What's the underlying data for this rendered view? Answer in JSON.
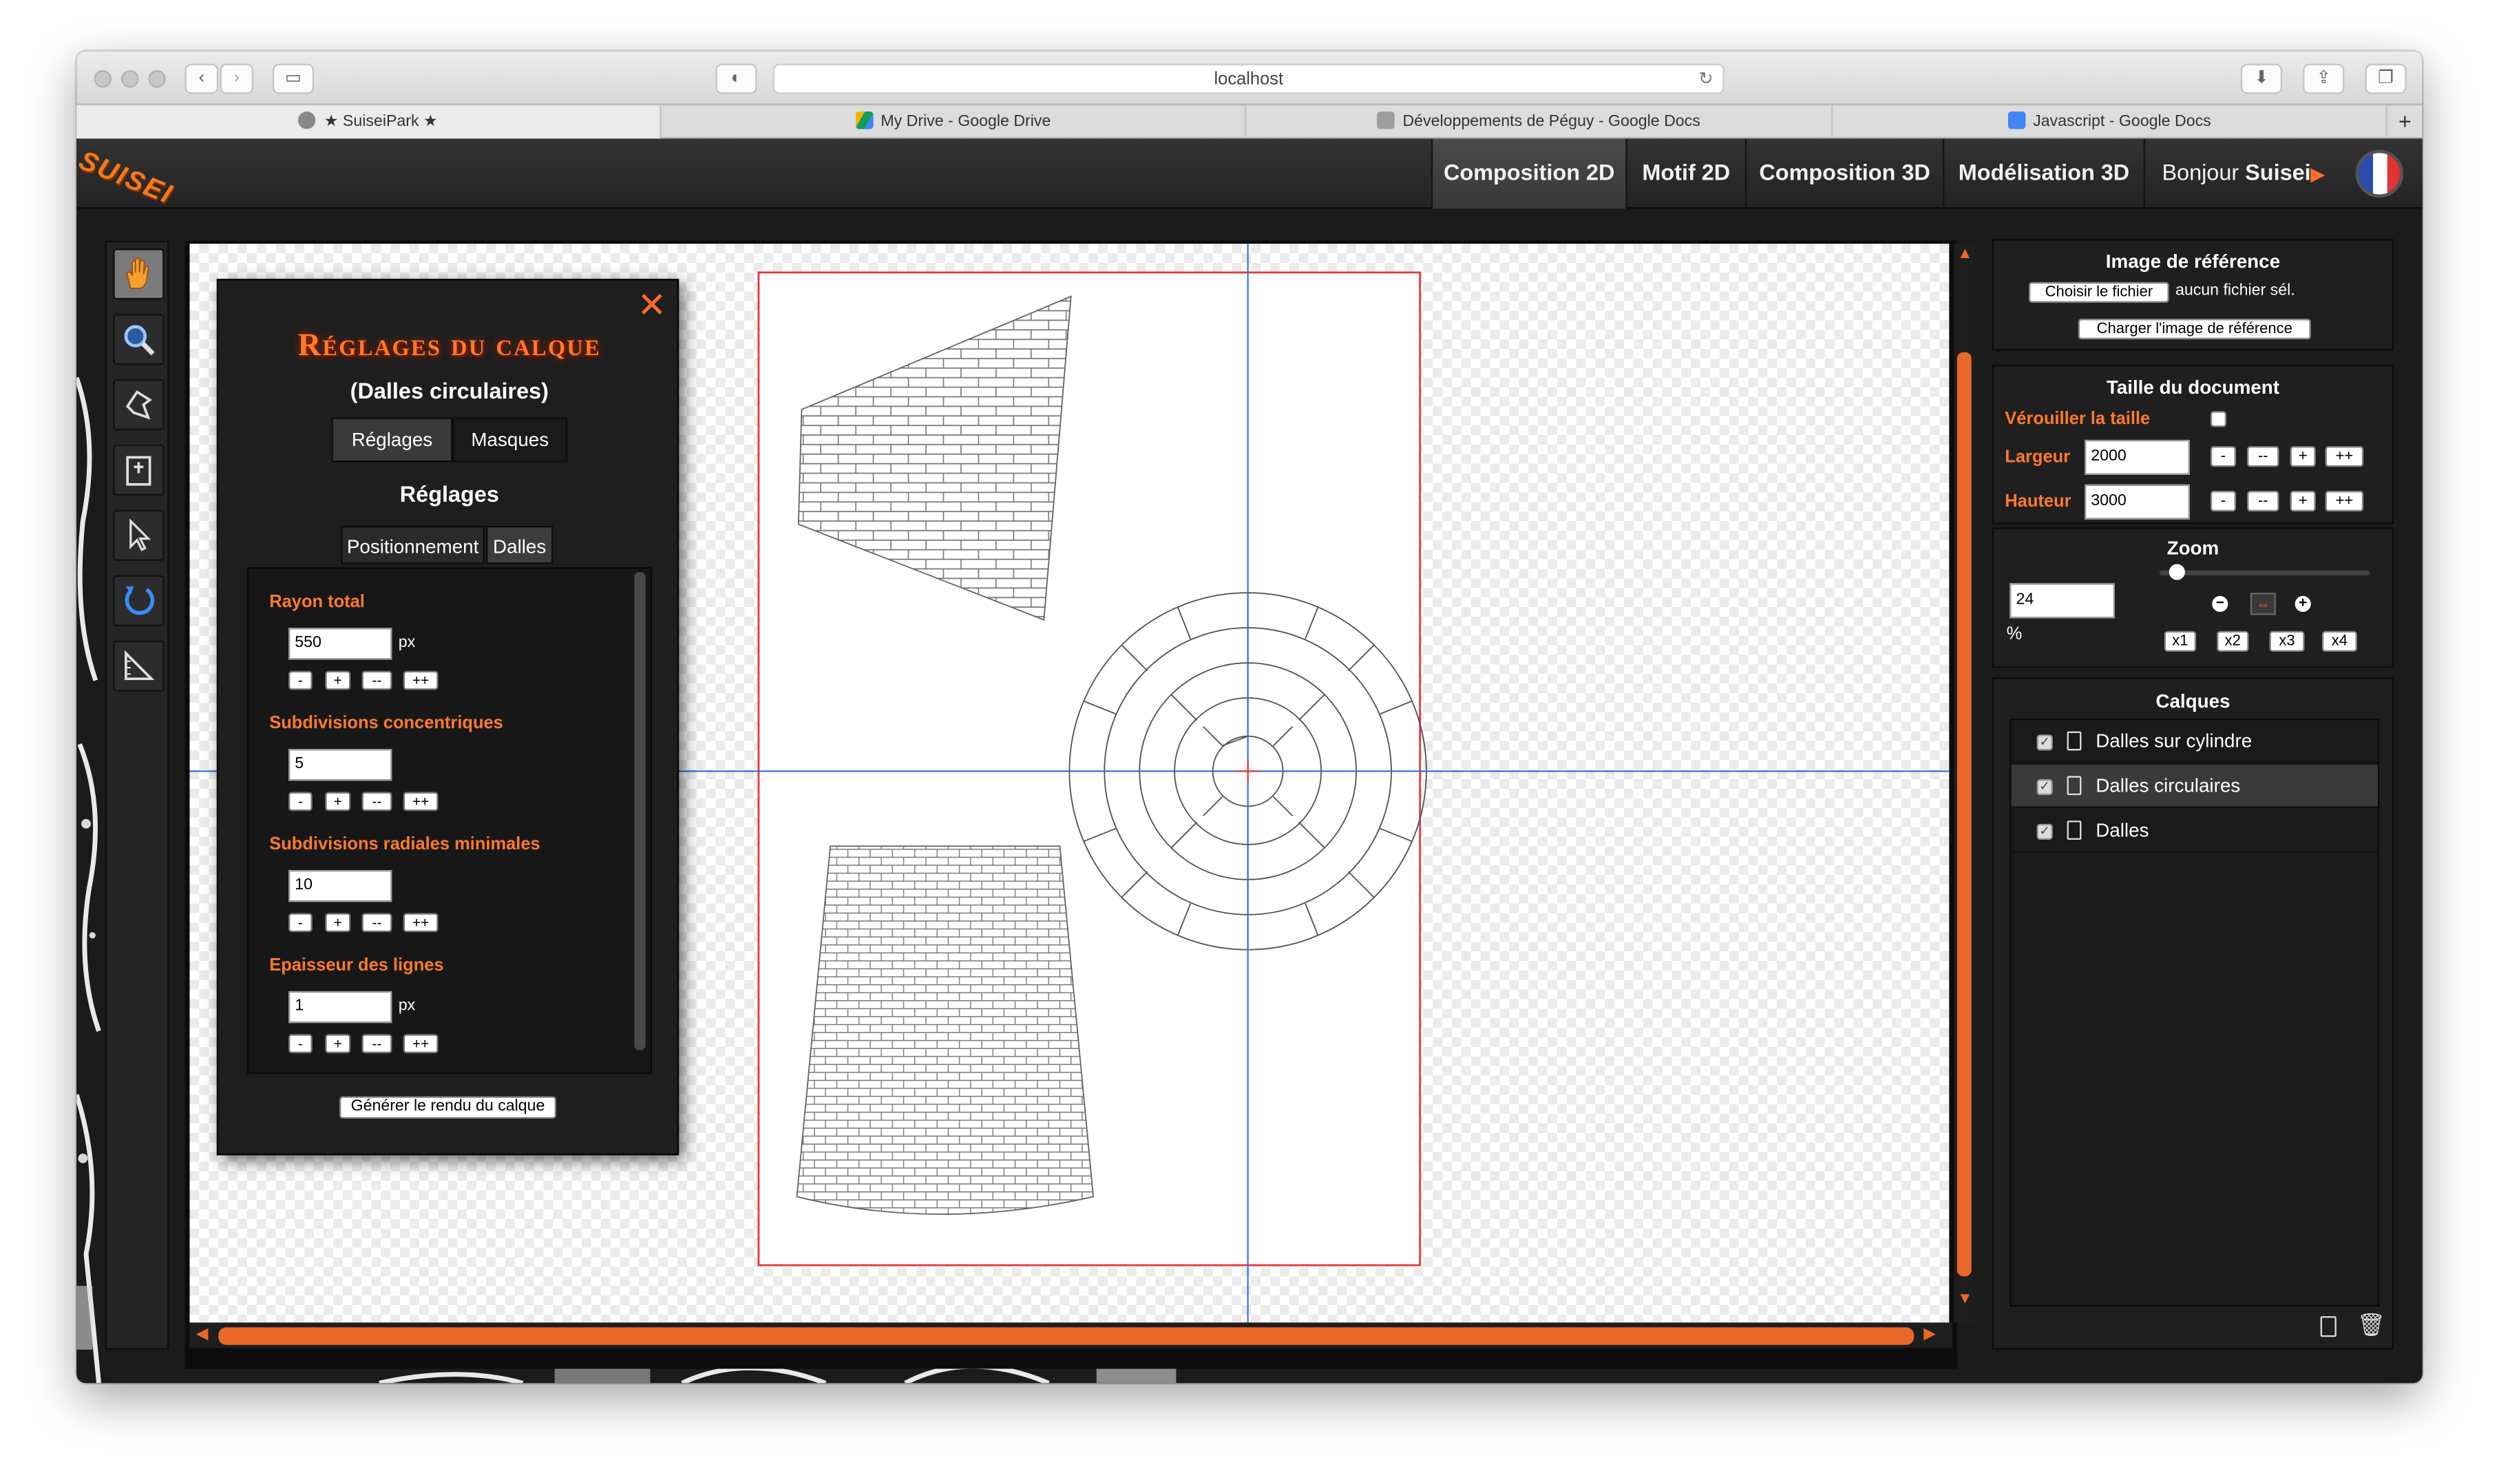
{
  "browser": {
    "url": "localhost",
    "tabs": [
      {
        "label": "★ SuiseiPark ★"
      },
      {
        "label": "My Drive - Google Drive"
      },
      {
        "label": "Développements de Péguy - Google Docs"
      },
      {
        "label": "Javascript - Google Docs"
      }
    ],
    "new_tab": "+"
  },
  "app": {
    "logo": "SUISEI",
    "nav": [
      {
        "label": "Composition 2D"
      },
      {
        "label": "Motif 2D"
      },
      {
        "label": "Composition 3D"
      },
      {
        "label": "Modélisation 3D"
      }
    ],
    "greeting": "Bonjour",
    "user": "Suisei",
    "tools": [
      "hand-icon",
      "zoom-icon",
      "polygon-icon",
      "crop-icon",
      "select-icon",
      "rotate-icon",
      "ruler-icon"
    ]
  },
  "panel": {
    "title": "Réglages du calque",
    "subtitle": "(Dalles circulaires)",
    "tabs": [
      "Réglages",
      "Masques"
    ],
    "section": "Réglages",
    "subtabs": [
      "Positionnement",
      "Dalles"
    ],
    "fields": [
      {
        "label": "Rayon total",
        "value": "550",
        "unit": "px"
      },
      {
        "label": "Subdivisions concentriques",
        "value": "5",
        "unit": ""
      },
      {
        "label": "Subdivisions radiales minimales",
        "value": "10",
        "unit": ""
      },
      {
        "label": "Epaisseur des lignes",
        "value": "1",
        "unit": "px"
      }
    ],
    "step_buttons": [
      "-",
      "+",
      "--",
      "++"
    ],
    "generate": "Générer le rendu du calque",
    "close": "✕"
  },
  "reference": {
    "title": "Image de référence",
    "choose": "Choisir le fichier",
    "nofile": "aucun fichier sél.",
    "load": "Charger l'image de référence"
  },
  "docsize": {
    "title": "Taille du document",
    "lock": "Vérouiller la taille",
    "width_label": "Largeur",
    "width": "2000",
    "height_label": "Hauteur",
    "height": "3000",
    "buttons": [
      "-",
      "--",
      "+",
      "++"
    ]
  },
  "zoom": {
    "title": "Zoom",
    "value": "24",
    "unit": "%",
    "level": 0.08,
    "presets": [
      "x1",
      "x2",
      "x3",
      "x4"
    ]
  },
  "layers": {
    "title": "Calques",
    "items": [
      {
        "label": "Dalles sur cylindre",
        "checked": true
      },
      {
        "label": "Dalles circulaires",
        "checked": true
      },
      {
        "label": "Dalles",
        "checked": true
      }
    ]
  },
  "colors": {
    "accent": "#e8692a",
    "label": "#ff7a2c",
    "guide": "#2a6fd6",
    "frame": "#e03a3a"
  }
}
